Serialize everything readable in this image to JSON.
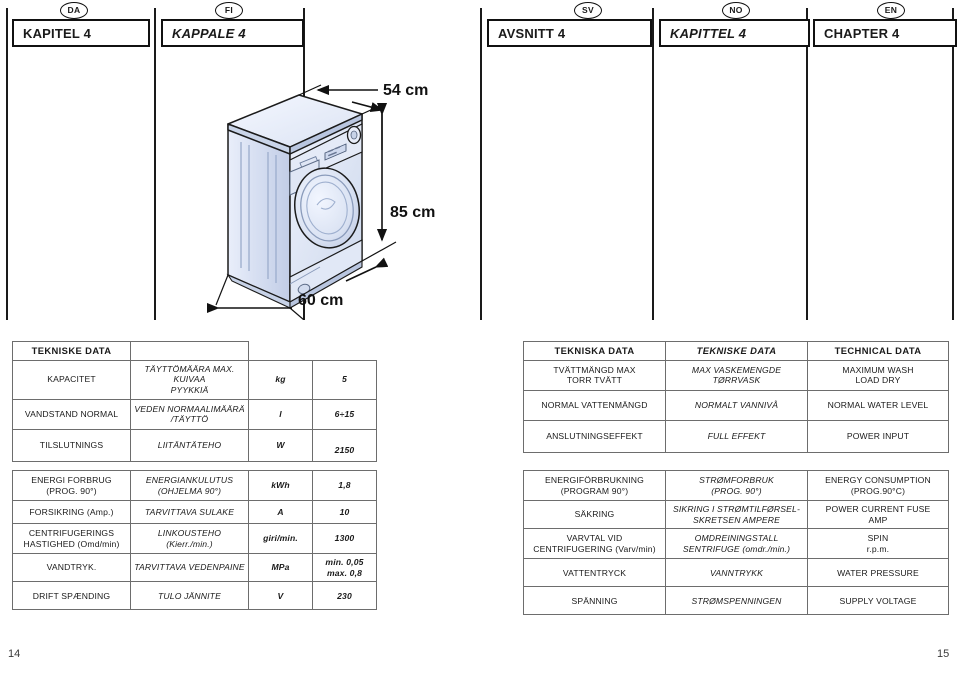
{
  "languages": [
    {
      "code": "DA",
      "chapter": "KAPITEL 4",
      "italic": false
    },
    {
      "code": "FI",
      "chapter": "KAPPALE 4",
      "italic": true
    },
    {
      "code": "SV",
      "chapter": "AVSNITT 4",
      "italic": false
    },
    {
      "code": "NO",
      "chapter": "KAPITTEL 4",
      "italic": true
    },
    {
      "code": "EN",
      "chapter": "CHAPTER 4",
      "italic": false
    }
  ],
  "illustration": {
    "name": "washing-machine-dimensions",
    "depth_label": "54 cm",
    "height_label": "85 cm",
    "width_label": "60 cm",
    "body_color": "#dde5f3",
    "body_color_dark": "#c3cee4",
    "line_color": "#1b1b1b"
  },
  "left_table": {
    "headers": [
      "TEKNISKE DATA",
      "",
      "",
      ""
    ],
    "rows": [
      {
        "da": "KAPACITET",
        "fi": "TÄYTTÖMÄÄRA MAX. KUIVAA\nPYYKKIÄ",
        "unit": "kg",
        "value": "5"
      },
      {
        "da": "VANDSTAND NORMAL",
        "fi": "VEDEN NORMAALIMÄÄRÄ\n/TÄYTTÖ",
        "unit": "l",
        "value": "6÷15"
      },
      {
        "da": "TILSLUTNINGS",
        "fi": "LIITÄNTÄTEHO",
        "unit": "W",
        "value": "2150"
      },
      {
        "da": "ENERGI FORBRUG\n(PROG. 90°)",
        "fi": "ENERGIANKULUTUS\n(OHJELMA 90°)",
        "unit": "kWh",
        "value": "1,8"
      },
      {
        "da": "FORSIKRING (Amp.)",
        "fi": "TARVITTAVA SULAKE",
        "unit": "A",
        "value": "10"
      },
      {
        "da": "CENTRIFUGERINGS\nHASTIGHED (Omd/min)",
        "fi": "LINKOUSTEHO\n(Kierr./min.)",
        "unit": "giri/min.",
        "value": "1300"
      },
      {
        "da": "VANDTRYK.",
        "fi": "TARVITTAVA VEDENPAINE",
        "unit": "MPa",
        "value": "min. 0,05\nmax. 0,8"
      },
      {
        "da": "DRIFT SPÆNDING",
        "fi": "TULO JÄNNITE",
        "unit": "V",
        "value": "230"
      }
    ]
  },
  "right_table": {
    "headers": [
      "TEKNISKA DATA",
      "TEKNISKE DATA",
      "TECHNICAL DATA"
    ],
    "rows": [
      {
        "sv": "TVÄTTMÄNGD MAX\nTORR TVÄTT",
        "no": "MAX VASKEMENGDE\nTØRRVASK",
        "en": "MAXIMUM WASH\nLOAD DRY"
      },
      {
        "sv": "NORMAL VATTENMÄNGD",
        "no": "NORMALT VANNIVÅ",
        "en": "NORMAL WATER LEVEL"
      },
      {
        "sv": "ANSLUTNINGSEFFEKT",
        "no": "FULL EFFEKT",
        "en": "POWER INPUT"
      },
      {
        "sv": "ENERGIFÖRBRUKNING\n(PROGRAM 90°)",
        "no": "STRØMFORBRUK\n(PROG. 90°)",
        "en": "ENERGY CONSUMPTION\n(PROG.90°C)"
      },
      {
        "sv": "SÄKRING",
        "no": "SIKRING I STRØMTILFØRSEL-\nSKRETSEN AMPERE",
        "en": "POWER CURRENT FUSE\nAMP"
      },
      {
        "sv": "VARVTAL VID\nCENTRIFUGERING (Varv/min)",
        "no": "OMDREININGSTALL\nSENTRIFUGE (omdr./min.)",
        "en": "SPIN\nr.p.m."
      },
      {
        "sv": "VATTENTRYCK",
        "no": "VANNTRYKK",
        "en": "WATER PRESSURE"
      },
      {
        "sv": "SPÄNNING",
        "no": "STRØMSPENNINGEN",
        "en": "SUPPLY VOLTAGE"
      }
    ]
  },
  "footer": {
    "page_left": "14",
    "page_right": "15"
  }
}
